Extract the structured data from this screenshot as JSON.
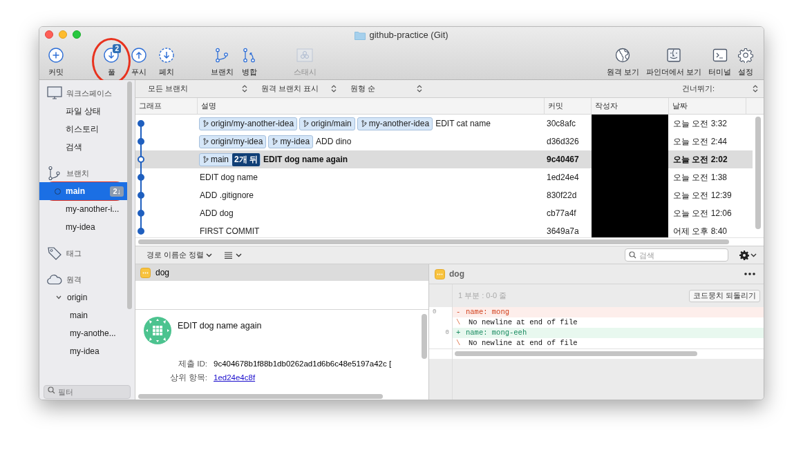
{
  "window": {
    "title": "github-practice (Git)"
  },
  "toolbar": {
    "left_groups": [
      [
        {
          "label": "커밋",
          "kind": "commit",
          "disabled": false
        }
      ],
      [
        {
          "label": "풀",
          "kind": "pull",
          "disabled": false,
          "badge": "2",
          "annotated": true
        },
        {
          "label": "푸시",
          "kind": "push",
          "disabled": false
        },
        {
          "label": "페치",
          "kind": "fetch",
          "disabled": false
        }
      ],
      [
        {
          "label": "브랜치",
          "kind": "branch",
          "disabled": false
        },
        {
          "label": "병합",
          "kind": "merge",
          "disabled": false
        }
      ],
      [
        {
          "label": "스태시",
          "kind": "stash",
          "disabled": true
        }
      ]
    ],
    "right": [
      {
        "label": "원격 보기",
        "kind": "remote",
        "disabled": false
      },
      {
        "label": "파인더에서 보기",
        "kind": "finder",
        "disabled": false
      },
      {
        "label": "터미널",
        "kind": "terminal",
        "disabled": false
      },
      {
        "label": "설정",
        "kind": "settings",
        "disabled": false
      }
    ]
  },
  "sidebar": {
    "sections": [
      {
        "label": "워크스페이스",
        "kind": "workspace",
        "items": [
          {
            "label": "파일 상태",
            "selected": false
          },
          {
            "label": "히스토리",
            "selected": false
          },
          {
            "label": "검색",
            "selected": false
          }
        ]
      },
      {
        "label": "브랜치",
        "kind": "branches",
        "items": [
          {
            "label": "main",
            "selected": true,
            "current": true,
            "badge": "2↓",
            "annotated": true
          },
          {
            "label": "my-another-i...",
            "selected": false,
            "current": false
          },
          {
            "label": "my-idea",
            "selected": false,
            "current": false
          }
        ]
      },
      {
        "label": "태그",
        "kind": "tags"
      },
      {
        "label": "원격",
        "kind": "remotes",
        "items": [
          {
            "label": "origin",
            "selected": false,
            "expanded": true,
            "children": [
              {
                "label": "main",
                "selected": false
              },
              {
                "label": "my-anothe...",
                "selected": false
              },
              {
                "label": "my-idea",
                "selected": false
              }
            ]
          }
        ]
      }
    ],
    "filter": {
      "placeholder": "필터"
    }
  },
  "filter_bar": {
    "selects": [
      "모든 브랜치",
      "원격 브랜치 표시",
      "원형 순"
    ],
    "skip_label": "건너뛰기:"
  },
  "table": {
    "columns": [
      "그래프",
      "설명",
      "커밋",
      "작성자",
      "날짜"
    ],
    "rows": [
      {
        "refs": [
          {
            "name": "origin/my-another-idea"
          },
          {
            "name": "origin/main"
          },
          {
            "name": "my-another-idea"
          }
        ],
        "message": "EDIT cat name",
        "commit": "30c8afc",
        "author_redacted": true,
        "date": "오늘 오전 3:32",
        "selected": false,
        "head": false
      },
      {
        "refs": [
          {
            "name": "origin/my-idea"
          },
          {
            "name": "my-idea"
          }
        ],
        "message": "ADD dino",
        "commit": "d36d326",
        "author_redacted": true,
        "date": "오늘 오전 2:44",
        "selected": false,
        "head": false
      },
      {
        "refs": [
          {
            "name": "main",
            "behind": "2개 뒤"
          }
        ],
        "message": "EDIT dog name again",
        "commit": "9c40467",
        "author_redacted": true,
        "date": "오늘 오전 2:02",
        "selected": true,
        "head": true
      },
      {
        "refs": [],
        "message": "EDIT dog name",
        "commit": "1ed24e4",
        "author_redacted": true,
        "date": "오늘 오전 1:38",
        "selected": false,
        "head": false
      },
      {
        "refs": [],
        "message": "ADD .gitignore",
        "commit": "830f22d",
        "author_redacted": true,
        "date": "오늘 오전 12:39",
        "selected": false,
        "head": false
      },
      {
        "refs": [],
        "message": "ADD dog",
        "commit": "cb77a4f",
        "author_redacted": true,
        "date": "오늘 오전 12:06",
        "selected": false,
        "head": false
      },
      {
        "refs": [],
        "message": "FIRST COMMIT",
        "commit": "3649a7a",
        "author_redacted": true,
        "date": "어제 오후 8:40",
        "selected": false,
        "head": false
      }
    ]
  },
  "lower_toolbar": {
    "sort": "경로 이름순 정렬",
    "search": {
      "placeholder": "검색"
    }
  },
  "files": [
    {
      "name": "dog",
      "selected": true
    }
  ],
  "commit_details": {
    "message": "EDIT dog name again",
    "fields": [
      {
        "label": "제출 ID:",
        "value": "9c404678b1f88b1db0262ad1d6b6c48e5197a42c [",
        "kind": "text"
      },
      {
        "label": "상위 항목:",
        "value": "1ed24e4c8f",
        "kind": "link"
      }
    ]
  },
  "diff": {
    "file": "dog",
    "hunk": "1 부분 : 0-0 줄",
    "revert_button": "코드뭉치 되돌리기",
    "lines": [
      {
        "kind": "removed",
        "old": "0",
        "sign": "-",
        "text": "name: mong"
      },
      {
        "kind": "note",
        "sign": "\\",
        "text": "No newline at end of file"
      },
      {
        "kind": "added",
        "new": "0",
        "sign": "+",
        "text": "name: mong-eeh"
      },
      {
        "kind": "note",
        "sign": "\\",
        "text": "No newline at end of file"
      }
    ]
  }
}
